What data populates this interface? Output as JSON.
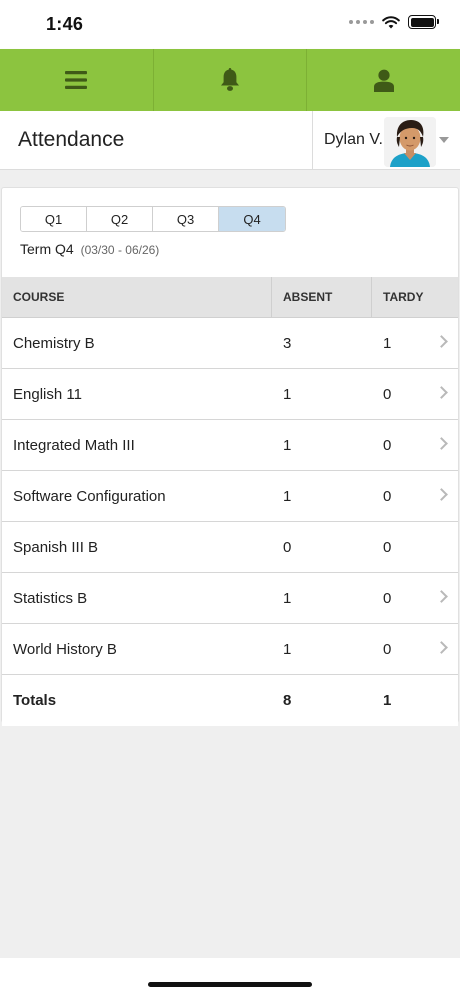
{
  "status": {
    "time": "1:46"
  },
  "nav": {
    "icons": [
      "menu-icon",
      "bell-icon",
      "person-icon"
    ]
  },
  "header": {
    "title": "Attendance",
    "user_name": "Dylan V."
  },
  "terms": {
    "tabs": [
      "Q1",
      "Q2",
      "Q3",
      "Q4"
    ],
    "active": "Q4",
    "label": "Term Q4",
    "range": "(03/30 - 06/26)"
  },
  "table": {
    "headers": {
      "course": "COURSE",
      "absent": "ABSENT",
      "tardy": "TARDY"
    },
    "rows": [
      {
        "course": "Chemistry B",
        "absent": "3",
        "tardy": "1",
        "has_detail": true
      },
      {
        "course": "English 11",
        "absent": "1",
        "tardy": "0",
        "has_detail": true
      },
      {
        "course": "Integrated Math III",
        "absent": "1",
        "tardy": "0",
        "has_detail": true
      },
      {
        "course": "Software Configuration",
        "absent": "1",
        "tardy": "0",
        "has_detail": true
      },
      {
        "course": "Spanish III B",
        "absent": "0",
        "tardy": "0",
        "has_detail": false
      },
      {
        "course": "Statistics B",
        "absent": "1",
        "tardy": "0",
        "has_detail": true
      },
      {
        "course": "World History B",
        "absent": "1",
        "tardy": "0",
        "has_detail": true
      }
    ],
    "totals": {
      "label": "Totals",
      "absent": "8",
      "tardy": "1"
    }
  },
  "colors": {
    "nav_green": "#8cc43f",
    "icon_dark_green": "#3f5a17",
    "active_tab": "#c7ddef"
  }
}
